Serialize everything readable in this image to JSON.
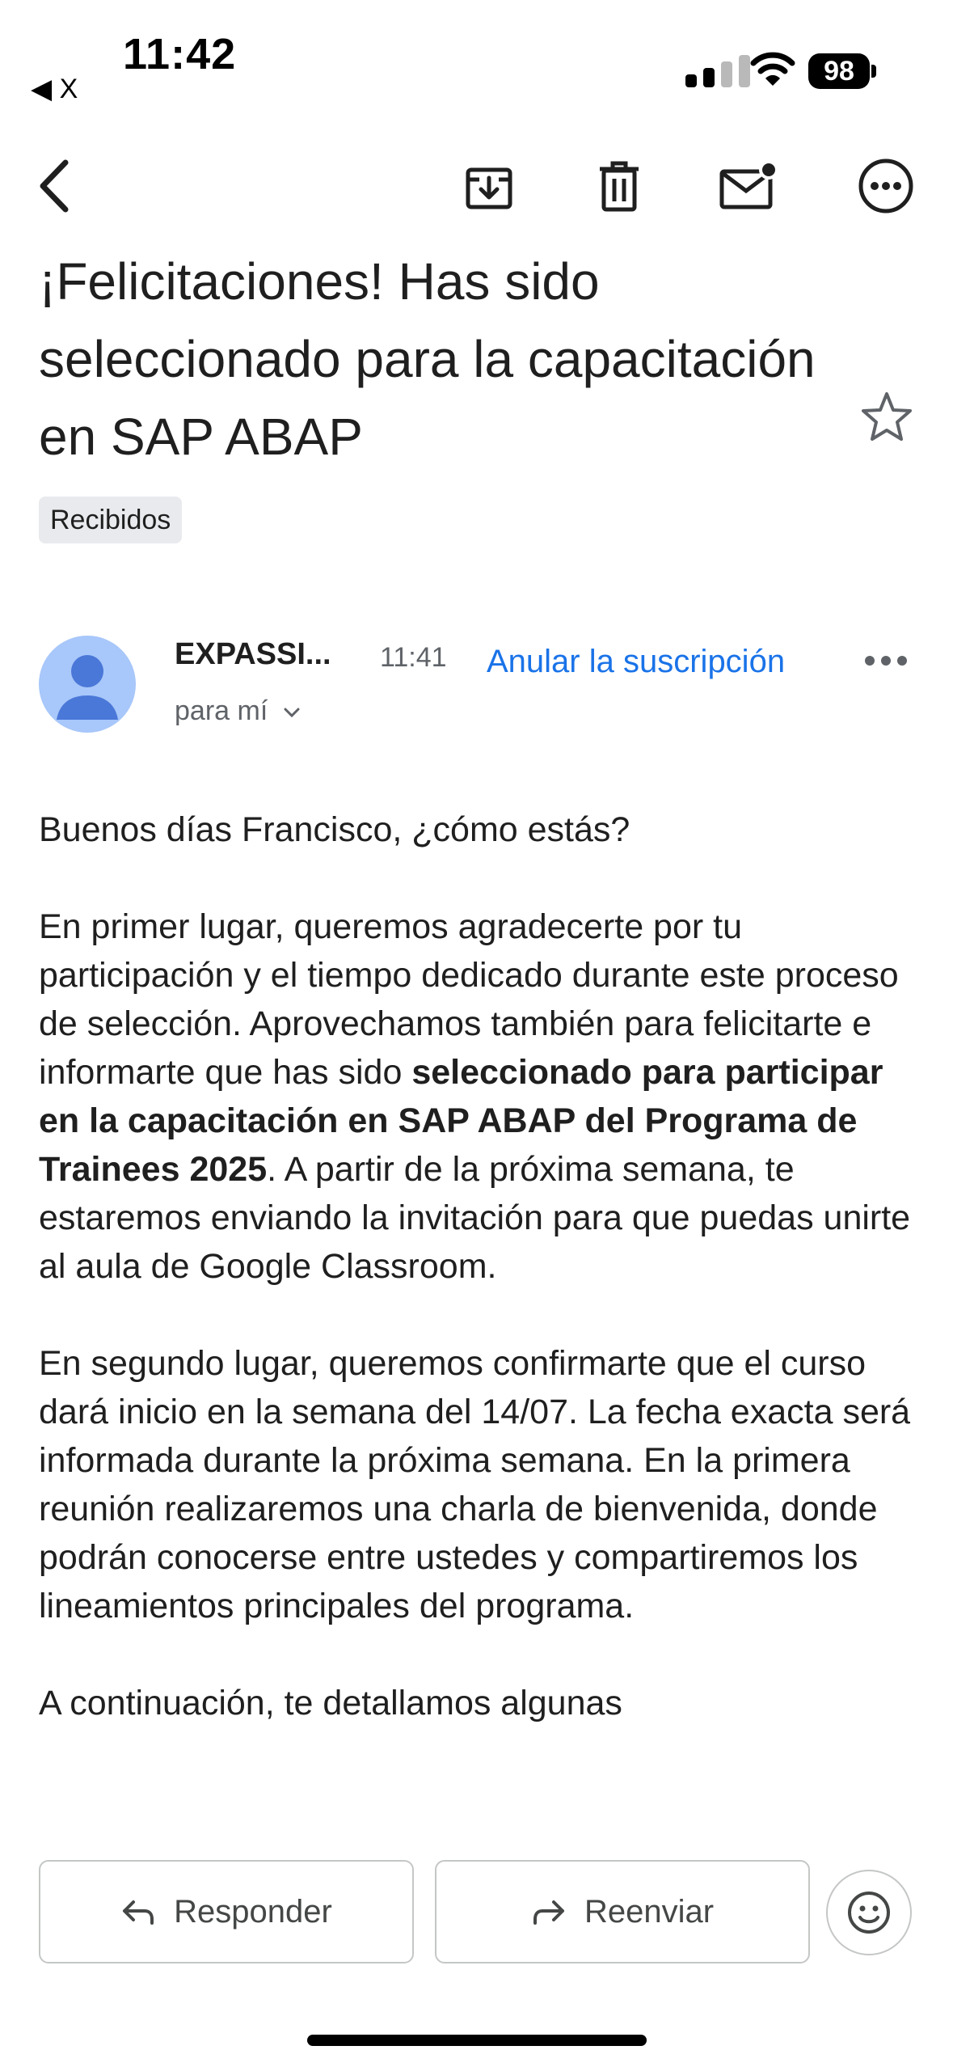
{
  "status_bar": {
    "time": "11:42",
    "back_app": "◀ X",
    "battery": "98"
  },
  "toolbar": {
    "icons": [
      "back-arrow-icon",
      "archive-icon",
      "trash-icon",
      "mark-unread-icon",
      "more-options-icon"
    ]
  },
  "email": {
    "subject": "¡Felicitaciones! Has sido seleccionado para la capacitación en SAP ABAP",
    "label": "Recibidos",
    "sender": "EXPASSI...",
    "time": "11:41",
    "unsubscribe": "Anular la suscripción",
    "recipient": "para mí",
    "greeting": "Buenos días Francisco, ¿cómo estás?",
    "p1_start": "En primer lugar, queremos agradecerte por tu participación y el tiempo dedicado durante este proceso de selección. Aprovechamos también para felicitarte e informarte que has sido ",
    "p1_bold": "seleccionado para participar en la capacitación en SAP ABAP del Programa de Trainees 2025",
    "p1_end": ". A partir de la próxima semana, te estaremos enviando la invitación para que puedas unirte al aula de Google Classroom.",
    "p2": "En segundo lugar, queremos confirmarte que el curso dará inicio en la semana del 14/07. La fecha exacta será informada durante la próxima semana. En la primera reunión realizaremos una charla de bienvenida, donde podrán conocerse entre ustedes y compartiremos los lineamientos principales del programa.",
    "p3": "A continuación, te detallamos algunas"
  },
  "actions": {
    "reply": "Responder",
    "forward": "Reenviar"
  },
  "colors": {
    "accent": "#1a73e8",
    "avatar_bg": "#a8c7fa",
    "avatar_fg": "#4a78d8",
    "chip_bg": "#e8eaed"
  }
}
